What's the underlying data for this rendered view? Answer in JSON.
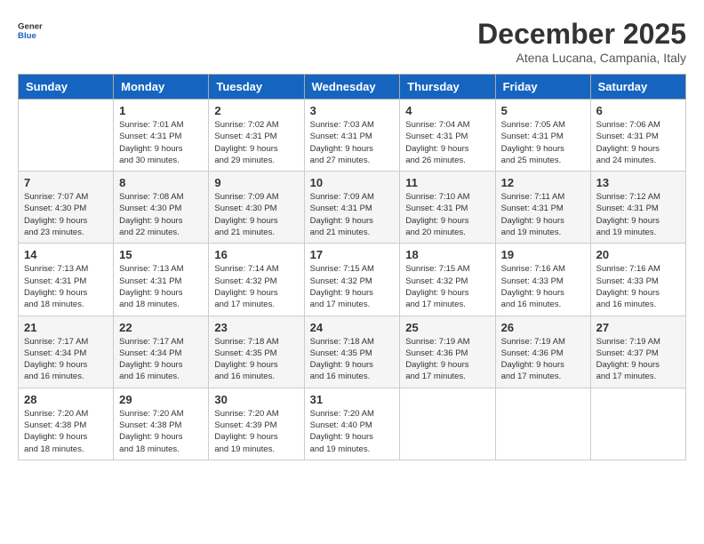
{
  "logo": {
    "general": "General",
    "blue": "Blue"
  },
  "header": {
    "month": "December 2025",
    "location": "Atena Lucana, Campania, Italy"
  },
  "weekdays": [
    "Sunday",
    "Monday",
    "Tuesday",
    "Wednesday",
    "Thursday",
    "Friday",
    "Saturday"
  ],
  "weeks": [
    [
      {
        "day": "",
        "info": ""
      },
      {
        "day": "1",
        "info": "Sunrise: 7:01 AM\nSunset: 4:31 PM\nDaylight: 9 hours\nand 30 minutes."
      },
      {
        "day": "2",
        "info": "Sunrise: 7:02 AM\nSunset: 4:31 PM\nDaylight: 9 hours\nand 29 minutes."
      },
      {
        "day": "3",
        "info": "Sunrise: 7:03 AM\nSunset: 4:31 PM\nDaylight: 9 hours\nand 27 minutes."
      },
      {
        "day": "4",
        "info": "Sunrise: 7:04 AM\nSunset: 4:31 PM\nDaylight: 9 hours\nand 26 minutes."
      },
      {
        "day": "5",
        "info": "Sunrise: 7:05 AM\nSunset: 4:31 PM\nDaylight: 9 hours\nand 25 minutes."
      },
      {
        "day": "6",
        "info": "Sunrise: 7:06 AM\nSunset: 4:31 PM\nDaylight: 9 hours\nand 24 minutes."
      }
    ],
    [
      {
        "day": "7",
        "info": "Sunrise: 7:07 AM\nSunset: 4:30 PM\nDaylight: 9 hours\nand 23 minutes."
      },
      {
        "day": "8",
        "info": "Sunrise: 7:08 AM\nSunset: 4:30 PM\nDaylight: 9 hours\nand 22 minutes."
      },
      {
        "day": "9",
        "info": "Sunrise: 7:09 AM\nSunset: 4:30 PM\nDaylight: 9 hours\nand 21 minutes."
      },
      {
        "day": "10",
        "info": "Sunrise: 7:09 AM\nSunset: 4:31 PM\nDaylight: 9 hours\nand 21 minutes."
      },
      {
        "day": "11",
        "info": "Sunrise: 7:10 AM\nSunset: 4:31 PM\nDaylight: 9 hours\nand 20 minutes."
      },
      {
        "day": "12",
        "info": "Sunrise: 7:11 AM\nSunset: 4:31 PM\nDaylight: 9 hours\nand 19 minutes."
      },
      {
        "day": "13",
        "info": "Sunrise: 7:12 AM\nSunset: 4:31 PM\nDaylight: 9 hours\nand 19 minutes."
      }
    ],
    [
      {
        "day": "14",
        "info": "Sunrise: 7:13 AM\nSunset: 4:31 PM\nDaylight: 9 hours\nand 18 minutes."
      },
      {
        "day": "15",
        "info": "Sunrise: 7:13 AM\nSunset: 4:31 PM\nDaylight: 9 hours\nand 18 minutes."
      },
      {
        "day": "16",
        "info": "Sunrise: 7:14 AM\nSunset: 4:32 PM\nDaylight: 9 hours\nand 17 minutes."
      },
      {
        "day": "17",
        "info": "Sunrise: 7:15 AM\nSunset: 4:32 PM\nDaylight: 9 hours\nand 17 minutes."
      },
      {
        "day": "18",
        "info": "Sunrise: 7:15 AM\nSunset: 4:32 PM\nDaylight: 9 hours\nand 17 minutes."
      },
      {
        "day": "19",
        "info": "Sunrise: 7:16 AM\nSunset: 4:33 PM\nDaylight: 9 hours\nand 16 minutes."
      },
      {
        "day": "20",
        "info": "Sunrise: 7:16 AM\nSunset: 4:33 PM\nDaylight: 9 hours\nand 16 minutes."
      }
    ],
    [
      {
        "day": "21",
        "info": "Sunrise: 7:17 AM\nSunset: 4:34 PM\nDaylight: 9 hours\nand 16 minutes."
      },
      {
        "day": "22",
        "info": "Sunrise: 7:17 AM\nSunset: 4:34 PM\nDaylight: 9 hours\nand 16 minutes."
      },
      {
        "day": "23",
        "info": "Sunrise: 7:18 AM\nSunset: 4:35 PM\nDaylight: 9 hours\nand 16 minutes."
      },
      {
        "day": "24",
        "info": "Sunrise: 7:18 AM\nSunset: 4:35 PM\nDaylight: 9 hours\nand 16 minutes."
      },
      {
        "day": "25",
        "info": "Sunrise: 7:19 AM\nSunset: 4:36 PM\nDaylight: 9 hours\nand 17 minutes."
      },
      {
        "day": "26",
        "info": "Sunrise: 7:19 AM\nSunset: 4:36 PM\nDaylight: 9 hours\nand 17 minutes."
      },
      {
        "day": "27",
        "info": "Sunrise: 7:19 AM\nSunset: 4:37 PM\nDaylight: 9 hours\nand 17 minutes."
      }
    ],
    [
      {
        "day": "28",
        "info": "Sunrise: 7:20 AM\nSunset: 4:38 PM\nDaylight: 9 hours\nand 18 minutes."
      },
      {
        "day": "29",
        "info": "Sunrise: 7:20 AM\nSunset: 4:38 PM\nDaylight: 9 hours\nand 18 minutes."
      },
      {
        "day": "30",
        "info": "Sunrise: 7:20 AM\nSunset: 4:39 PM\nDaylight: 9 hours\nand 19 minutes."
      },
      {
        "day": "31",
        "info": "Sunrise: 7:20 AM\nSunset: 4:40 PM\nDaylight: 9 hours\nand 19 minutes."
      },
      {
        "day": "",
        "info": ""
      },
      {
        "day": "",
        "info": ""
      },
      {
        "day": "",
        "info": ""
      }
    ]
  ]
}
